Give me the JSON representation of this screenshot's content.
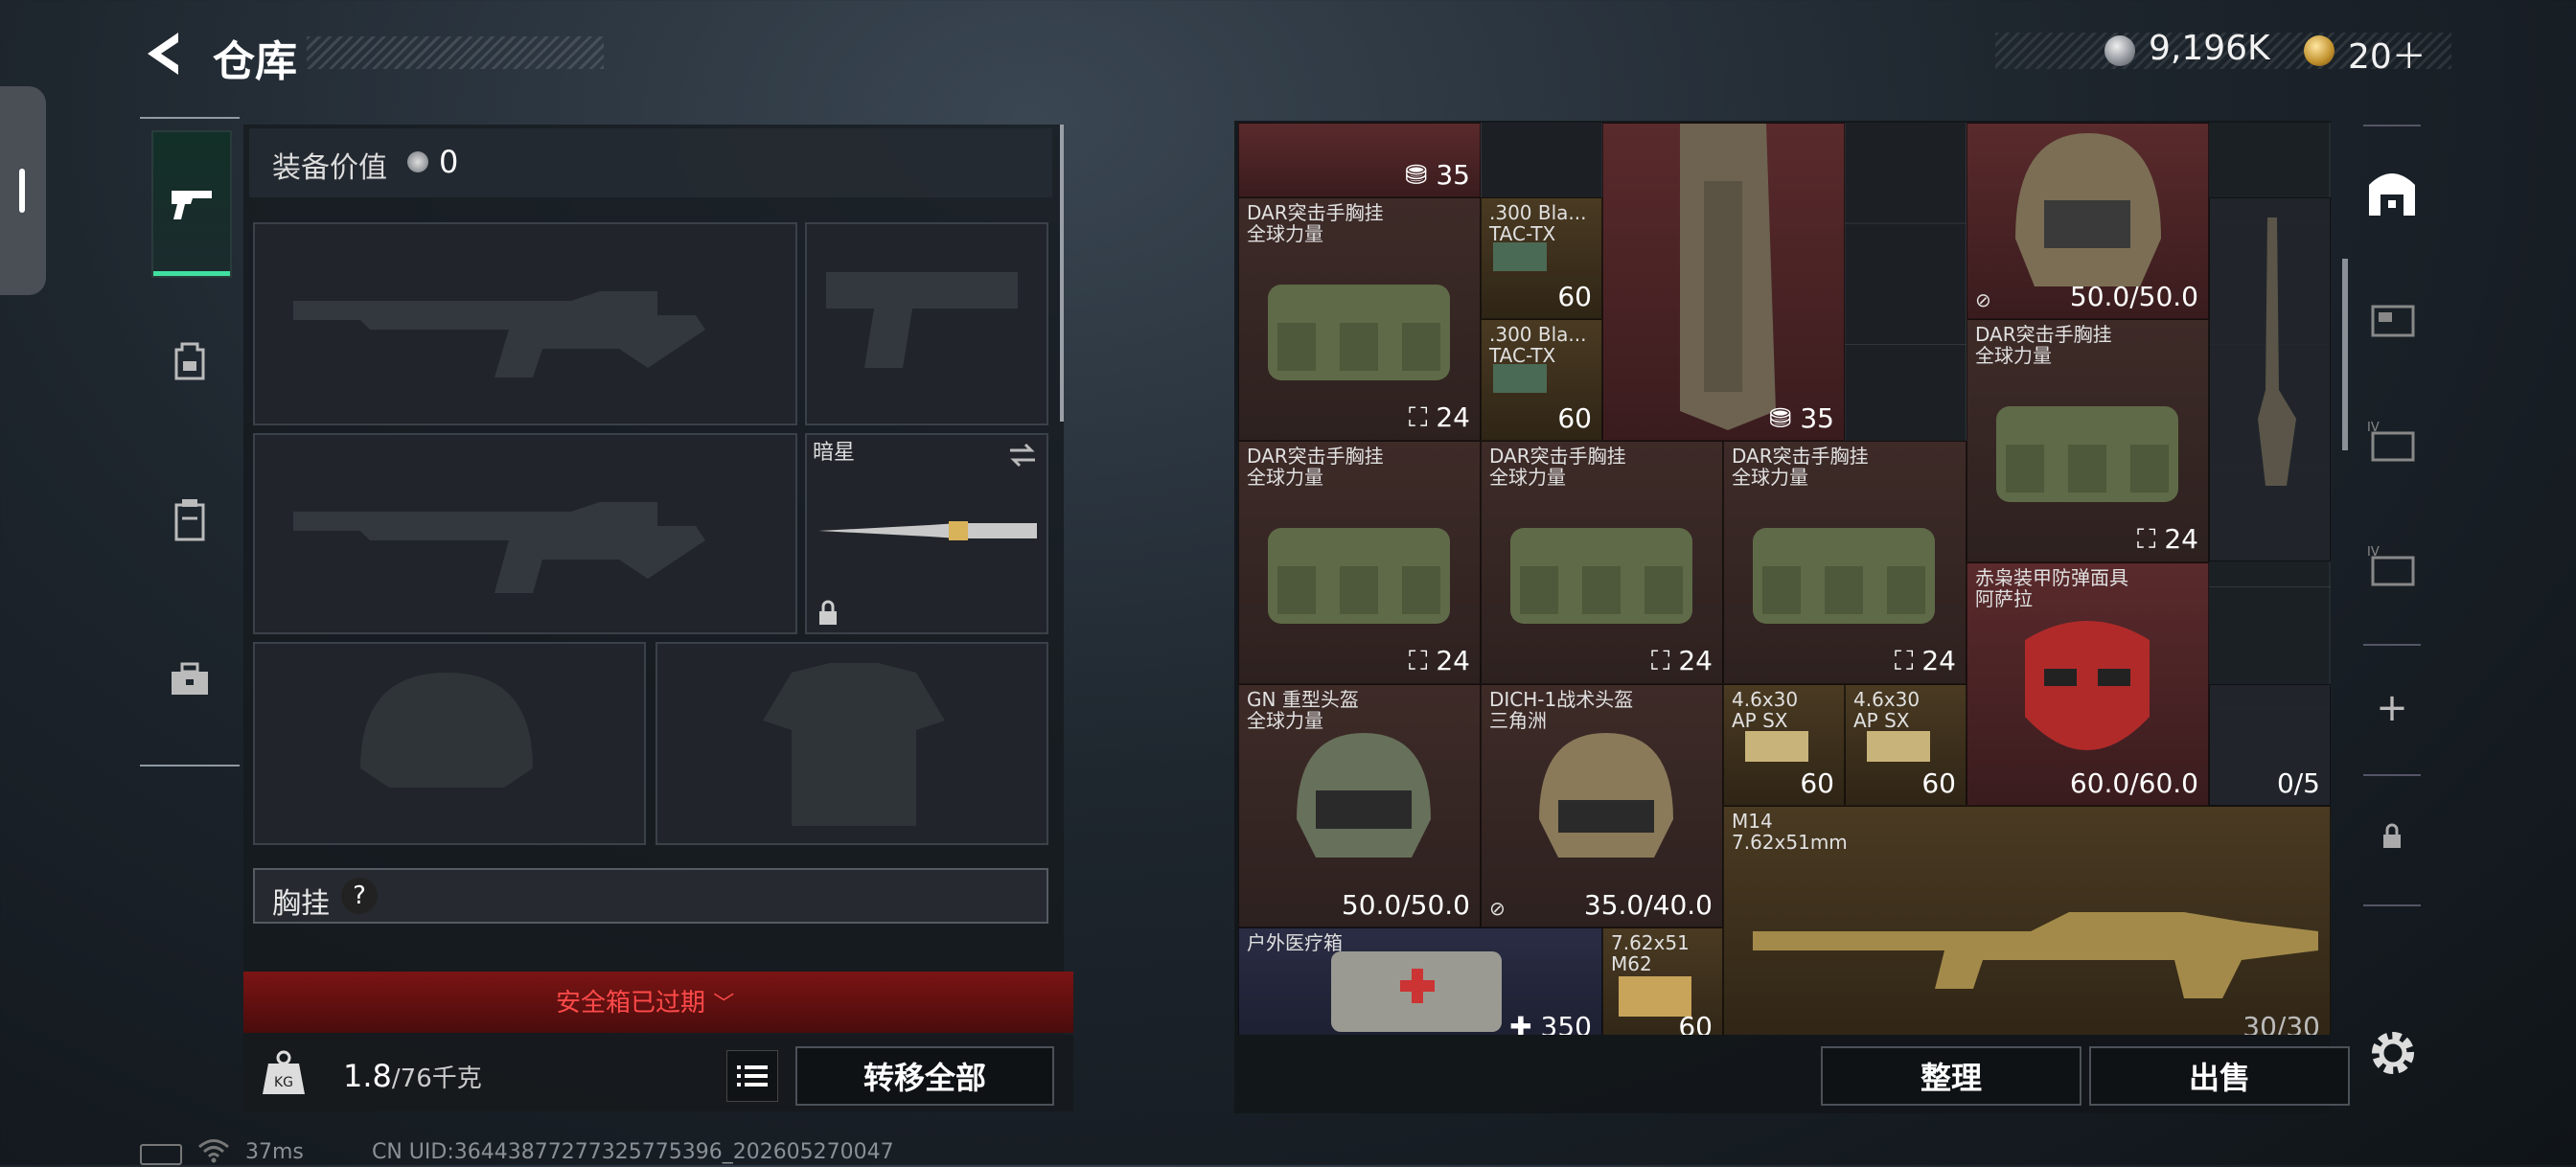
{
  "header": {
    "title": "仓库",
    "currency_silver": "9,196K",
    "currency_gold": "20＋"
  },
  "equipment": {
    "value_label": "装备价值",
    "value": "0",
    "melee_name": "暗星",
    "chest_label": "胸挂",
    "chest_help": "?"
  },
  "safe_box": {
    "status": "安全箱已过期"
  },
  "bottom_left": {
    "weight_current": "1.8",
    "weight_max": "/76千克",
    "transfer_label": "转移全部"
  },
  "status_bar": {
    "ping": "37ms",
    "uid": "CN UID:3644387727732577539​6_202605270047"
  },
  "stash": {
    "items": [
      {
        "name": "",
        "sub": "",
        "value": "35",
        "icon": "weight-icon"
      },
      {
        "name": "DAR突击手胸挂",
        "sub": "全球力量",
        "value": "24"
      },
      {
        "name": ".300 Bla...",
        "sub": "TAC-TX",
        "value": "60"
      },
      {
        "name": ".300 Bla...",
        "sub": "TAC-TX",
        "value": "60"
      },
      {
        "name": "",
        "sub": "",
        "value": "35"
      },
      {
        "name": "",
        "sub": "",
        "value": "50.0/50.0"
      },
      {
        "name": "DAR突击手胸挂",
        "sub": "全球力量",
        "value": "24"
      },
      {
        "name": "DAR突击手胸挂",
        "sub": "全球力量",
        "value": "24"
      },
      {
        "name": "DAR突击手胸挂",
        "sub": "全球力量",
        "value": "24"
      },
      {
        "name": "DAR突击手胸挂",
        "sub": "全球力量",
        "value": "24"
      },
      {
        "name": "赤枭装甲防弹面具",
        "sub": "阿萨拉",
        "value": "60.0/60.0"
      },
      {
        "name": "",
        "sub": "",
        "value": "0/5"
      },
      {
        "name": "GN 重型头盔",
        "sub": "全球力量",
        "value": "50.0/50.0"
      },
      {
        "name": "DICH-1战术头盔",
        "sub": "三角洲",
        "value": "35.0/40.0"
      },
      {
        "name": "4.6x30",
        "sub": "AP SX",
        "value": "60"
      },
      {
        "name": "4.6x30",
        "sub": "AP SX",
        "value": "60"
      },
      {
        "name": "M14",
        "sub": "7.62x51mm",
        "value": "30/30"
      },
      {
        "name": "户外医疗箱",
        "sub": "",
        "value": "350"
      },
      {
        "name": "7.62x51",
        "sub": "M62",
        "value": "60"
      }
    ],
    "sort_label": "整理",
    "sell_label": "出售",
    "add_symbol": "+"
  }
}
